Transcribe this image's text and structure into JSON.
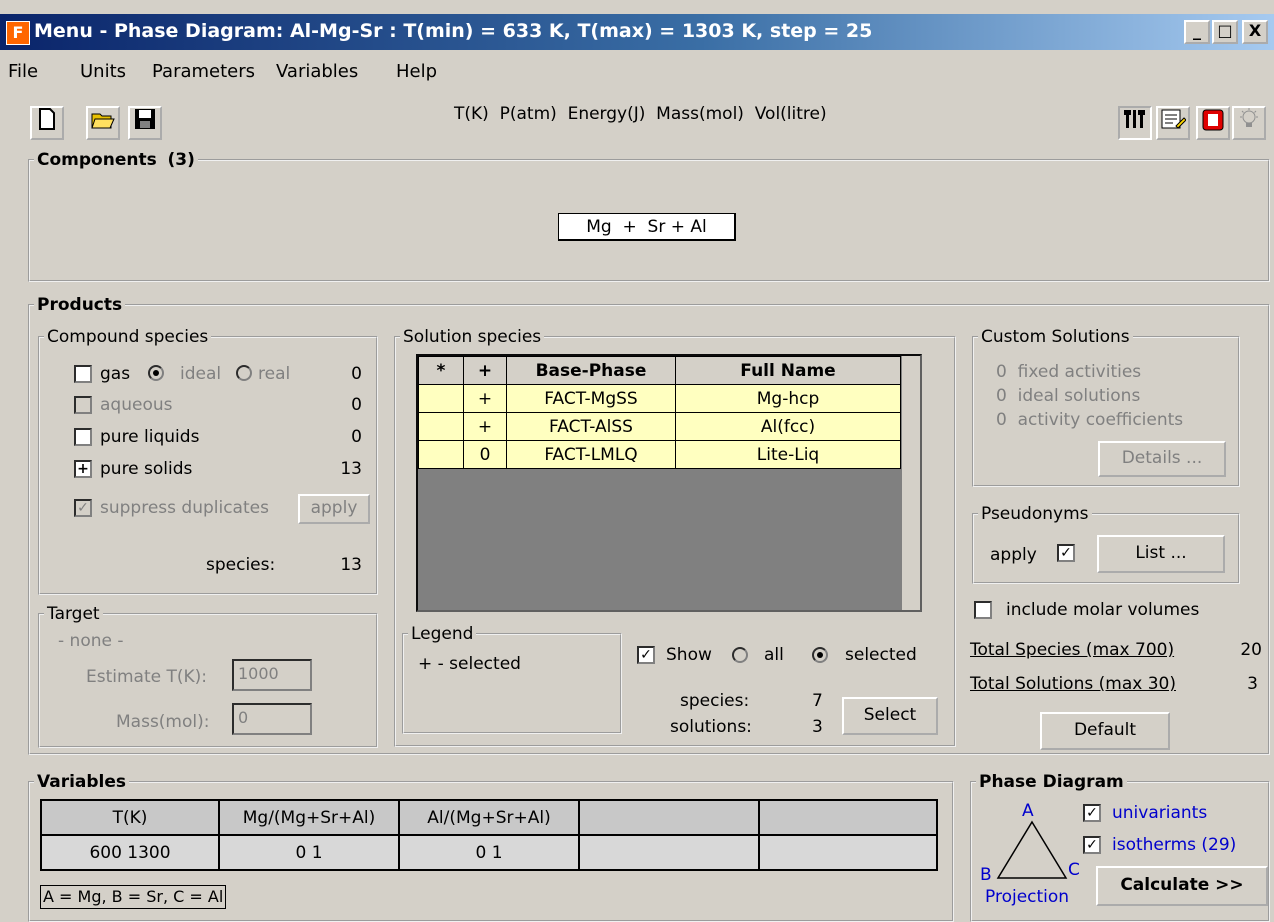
{
  "window": {
    "title": "Menu - Phase Diagram: Al-Mg-Sr : T(min) = 633 K, T(max) = 1303 K, step = 25",
    "icon_letter": "F",
    "controls": [
      "_",
      "□",
      "X"
    ]
  },
  "menu": [
    "File",
    "Units",
    "Parameters",
    "Variables",
    "Help"
  ],
  "toolbar": {
    "units_text": "T(K)  P(atm)  Energy(J)  Mass(mol)  Vol(litre)",
    "left_icons": [
      "new-icon",
      "open-icon",
      "save-icon"
    ],
    "right_icons": [
      "tools-icon",
      "notes-icon",
      "stop-icon",
      "bulb-icon"
    ]
  },
  "components": {
    "label": "Components",
    "count": "(3)",
    "value": "Mg  +  Sr + Al"
  },
  "products": {
    "label": "Products",
    "compound": {
      "label": "Compound species",
      "gas": "gas",
      "ideal": "ideal",
      "real": "real",
      "gas_count": "0",
      "aqueous": "aqueous",
      "aqueous_count": "0",
      "pure_liquids": "pure liquids",
      "pure_liquids_count": "0",
      "pure_solids": "pure solids",
      "pure_solids_mark": "+",
      "pure_solids_count": "13",
      "suppress": "suppress duplicates",
      "apply": "apply",
      "species_label": "species:",
      "species_count": "13"
    },
    "target": {
      "label": "Target",
      "none": "- none -",
      "estimate_label": "Estimate T(K):",
      "estimate_value": "1000",
      "mass_label": "Mass(mol):",
      "mass_value": "0"
    },
    "solution": {
      "label": "Solution species",
      "headers": [
        "*",
        "+",
        "Base-Phase",
        "Full Name"
      ],
      "rows": [
        [
          "",
          "+",
          "FACT-MgSS",
          "Mg-hcp"
        ],
        [
          "",
          "+",
          "FACT-AlSS",
          "Al(fcc)"
        ],
        [
          "",
          "0",
          "FACT-LMLQ",
          "Lite-Liq"
        ]
      ],
      "legend_label": "Legend",
      "legend_text": "+ - selected",
      "show": "Show",
      "all": "all",
      "selected": "selected",
      "species_label": "species:",
      "species_count": "7",
      "solutions_label": "solutions:",
      "solutions_count": "3",
      "select_button": "Select"
    },
    "custom": {
      "label": "Custom Solutions",
      "fixed": "0  fixed activities",
      "ideal": "0  ideal solutions",
      "activity": "0  activity coefficients",
      "details": "Details ..."
    },
    "pseudonyms": {
      "label": "Pseudonyms",
      "apply": "apply",
      "list": "List ..."
    },
    "molar": "include molar volumes",
    "total_species_label": "Total Species (max 700)",
    "total_species_value": "20",
    "total_solutions_label": "Total Solutions (max 30)",
    "total_solutions_value": "3",
    "default_button": "Default"
  },
  "variables": {
    "label": "Variables",
    "headers": [
      "T(K)",
      "Mg/(Mg+Sr+Al)",
      "Al/(Mg+Sr+Al)",
      "",
      ""
    ],
    "values": [
      "600 1300",
      "0 1",
      "0 1",
      "",
      ""
    ],
    "footer": "A = Mg, B = Sr, C = Al"
  },
  "phase_diagram": {
    "label": "Phase Diagram",
    "a": "A",
    "b": "B",
    "c": "C",
    "projection": "Projection",
    "univariants": "univariants",
    "isotherms": "isotherms (29)",
    "calculate": "Calculate >>"
  }
}
